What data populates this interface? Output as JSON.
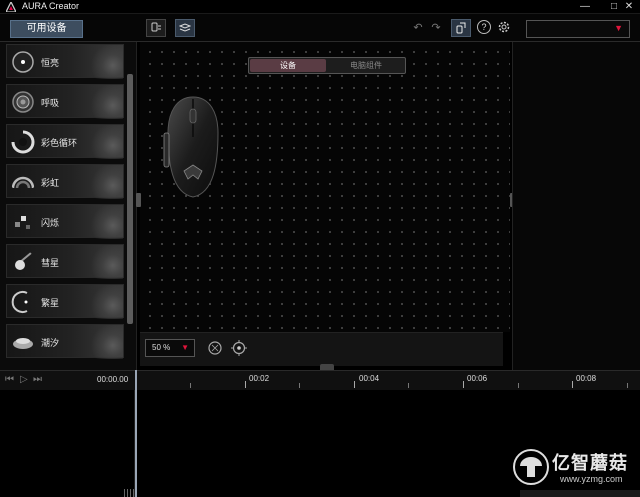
{
  "app": {
    "title": "AURA Creator",
    "window_controls": {
      "minimize": "—",
      "maximize": "□",
      "close": "✕"
    }
  },
  "toolbar": {
    "available_devices_label": "可用设备",
    "icons": [
      "device-sync-icon",
      "layers-icon",
      "undo-icon",
      "redo-icon",
      "device-view-icon",
      "help-icon",
      "settings-icon"
    ],
    "profile_dropdown_value": "",
    "accent_color": "#e0153b"
  },
  "effects": {
    "items": [
      {
        "label": "恒亮",
        "icon": "static-icon"
      },
      {
        "label": "呼吸",
        "icon": "breathing-icon"
      },
      {
        "label": "彩色循环",
        "icon": "color-cycle-icon"
      },
      {
        "label": "彩虹",
        "icon": "rainbow-icon"
      },
      {
        "label": "闪烁",
        "icon": "strobe-icon"
      },
      {
        "label": "彗星",
        "icon": "comet-icon"
      },
      {
        "label": "繁星",
        "icon": "starry-icon"
      },
      {
        "label": "潮汐",
        "icon": "tide-icon"
      }
    ]
  },
  "canvas": {
    "tabs": [
      {
        "label": "设备",
        "active": true
      },
      {
        "label": "电脑组件",
        "active": false
      }
    ],
    "device": "gaming-mouse",
    "zoom_value": "50 %"
  },
  "timeline": {
    "current_time": "00:00.00",
    "ruler_labels": [
      "00:02",
      "00:04",
      "00:06",
      "00:08"
    ],
    "controls": [
      "skip-start-icon",
      "play-icon",
      "skip-end-icon"
    ]
  },
  "watermark": {
    "text": "亿智蘑菇",
    "url": "www.yzmg.com"
  }
}
